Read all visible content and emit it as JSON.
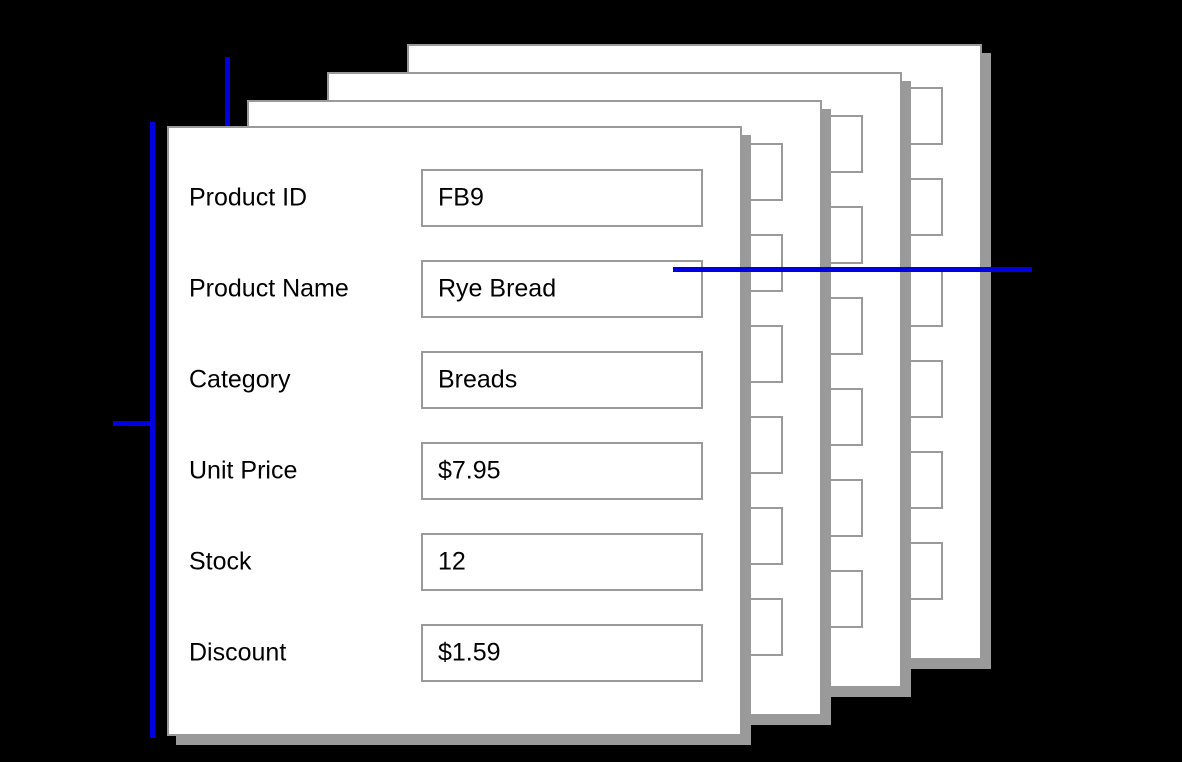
{
  "view": {
    "background_color": "#000000",
    "card_color": "#ffffff",
    "card_border_color": "#9a9a9a",
    "shadow_color": "#9a9a9a",
    "annotation_color": "#0000e0",
    "card_count": 4
  },
  "record": {
    "fields": [
      {
        "label": "Product ID",
        "value": "FB9"
      },
      {
        "label": "Product Name",
        "value": "Rye Bread"
      },
      {
        "label": "Category",
        "value": "Breads"
      },
      {
        "label": "Unit Price",
        "value": "$7.95"
      },
      {
        "label": "Stock",
        "value": "12"
      },
      {
        "label": "Discount",
        "value": "$1.59"
      }
    ]
  },
  "annotations": {
    "top_pointer": {
      "name": "card-top-pointer"
    },
    "left_bracket": {
      "name": "card-height-bracket"
    },
    "right_pointer": {
      "name": "stack-width-pointer"
    }
  }
}
